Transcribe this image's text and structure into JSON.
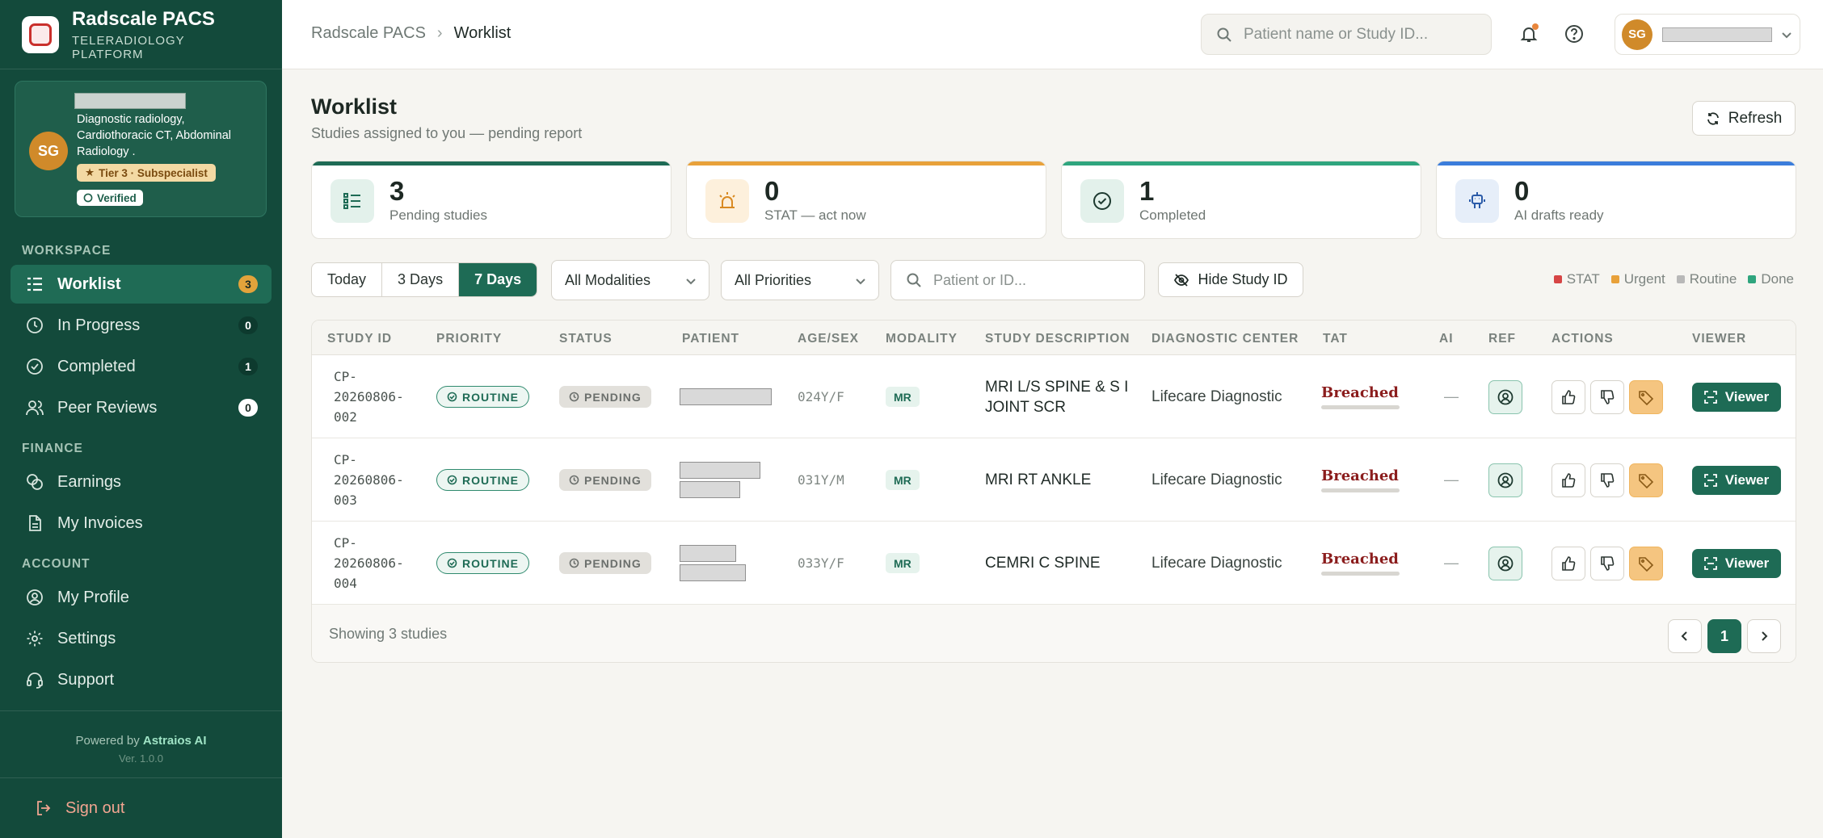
{
  "brand": {
    "title": "Radscale PACS",
    "subtitle": "TELERADIOLOGY PLATFORM"
  },
  "profile": {
    "initials": "SG",
    "specialties": "Diagnostic radiology, Cardiothoracic CT, Abdominal Radiology .",
    "tier": "Tier 3 · Subspecialist",
    "verified": "Verified"
  },
  "sidebar": {
    "workspace_label": "WORKSPACE",
    "finance_label": "FINANCE",
    "account_label": "ACCOUNT",
    "workspace": [
      {
        "label": "Worklist",
        "count": "3",
        "icon": "worklist-icon"
      },
      {
        "label": "In Progress",
        "count": "0",
        "icon": "clock-icon"
      },
      {
        "label": "Completed",
        "count": "1",
        "icon": "check-circle-icon"
      },
      {
        "label": "Peer Reviews",
        "count": "0",
        "icon": "users-icon"
      }
    ],
    "finance": [
      {
        "label": "Earnings",
        "icon": "coins-icon"
      },
      {
        "label": "My Invoices",
        "icon": "invoice-icon"
      }
    ],
    "account": [
      {
        "label": "My Profile",
        "icon": "user-circle-icon"
      },
      {
        "label": "Settings",
        "icon": "gear-icon"
      },
      {
        "label": "Support",
        "icon": "headset-icon"
      }
    ],
    "powered_prefix": "Powered by",
    "powered_brand": "Astraios AI",
    "version": "Ver. 1.0.0",
    "signout": "Sign out"
  },
  "topbar": {
    "breadcrumb_root": "Radscale PACS",
    "breadcrumb_sep": "›",
    "breadcrumb_current": "Worklist",
    "search_placeholder": "Patient name or Study ID...",
    "user_initials": "SG"
  },
  "header": {
    "title": "Worklist",
    "subtitle": "Studies assigned to you — pending report",
    "refresh": "Refresh"
  },
  "stats": [
    {
      "value": "3",
      "label": "Pending studies",
      "color": "#1e6b55",
      "icon": "list-icon"
    },
    {
      "value": "0",
      "label": "STAT — act now",
      "color": "#e8a13a",
      "icon": "alarm-icon"
    },
    {
      "value": "1",
      "label": "Completed",
      "color": "#2fa57e",
      "icon": "check-circle-icon"
    },
    {
      "value": "0",
      "label": "AI drafts ready",
      "color": "#3b7ddb",
      "icon": "robot-icon"
    }
  ],
  "filters": {
    "ranges": [
      "Today",
      "3 Days",
      "7 Days"
    ],
    "active_range": "7 Days",
    "modality": "All Modalities",
    "priority": "All Priorities",
    "search_placeholder": "Patient or ID...",
    "hide_study_id": "Hide Study ID"
  },
  "legend": [
    {
      "label": "STAT",
      "color": "#d64545"
    },
    {
      "label": "Urgent",
      "color": "#e8a13a"
    },
    {
      "label": "Routine",
      "color": "#b8b8b8"
    },
    {
      "label": "Done",
      "color": "#2fa57e"
    }
  ],
  "table": {
    "columns": [
      "STUDY ID",
      "PRIORITY",
      "STATUS",
      "PATIENT",
      "AGE/SEX",
      "MODALITY",
      "STUDY DESCRIPTION",
      "DIAGNOSTIC CENTER",
      "TAT",
      "AI",
      "REF",
      "ACTIONS",
      "VIEWER"
    ],
    "rows": [
      {
        "study_id": "CP-\n20260806-\n002",
        "priority": "ROUTINE",
        "status": "PENDING",
        "age_sex": "024Y/F",
        "modality": "MR",
        "description": "MRI L/S SPINE & S I JOINT SCR",
        "center": "Lifecare Diagnostic",
        "tat": "Breached",
        "ai": "—",
        "viewer": "Viewer"
      },
      {
        "study_id": "CP-\n20260806-\n003",
        "priority": "ROUTINE",
        "status": "PENDING",
        "age_sex": "031Y/M",
        "modality": "MR",
        "description": "MRI RT ANKLE",
        "center": "Lifecare Diagnostic",
        "tat": "Breached",
        "ai": "—",
        "viewer": "Viewer"
      },
      {
        "study_id": "CP-\n20260806-\n004",
        "priority": "ROUTINE",
        "status": "PENDING",
        "age_sex": "033Y/F",
        "modality": "MR",
        "description": "CEMRI C SPINE",
        "center": "Lifecare Diagnostic",
        "tat": "Breached",
        "ai": "—",
        "viewer": "Viewer"
      }
    ],
    "showing": "Showing 3 studies",
    "page": "1"
  }
}
